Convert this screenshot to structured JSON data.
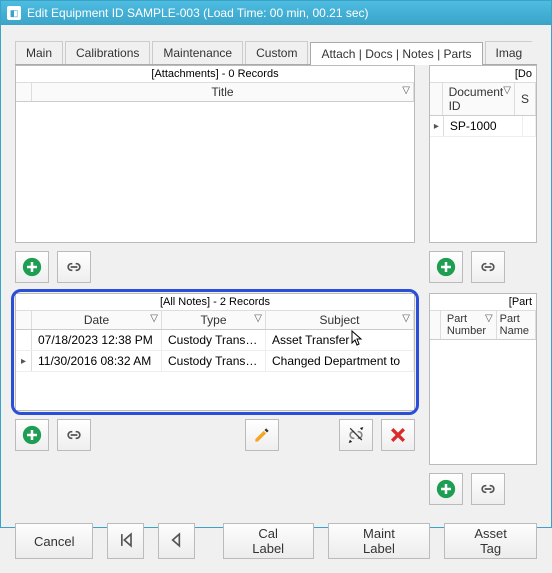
{
  "window": {
    "title": "Edit Equipment ID SAMPLE-003 (Load Time: 00 min, 00.21 sec)"
  },
  "tabs": {
    "main": "Main",
    "cal": "Calibrations",
    "maint": "Maintenance",
    "custom": "Custom",
    "attach": "Attach | Docs | Notes | Parts",
    "imag": "Imag"
  },
  "attach": {
    "caption": "[Attachments] - 0 Records",
    "col_title": "Title"
  },
  "docs": {
    "caption": "[Do",
    "col_id": "Document ID",
    "col_s": "S",
    "rows": [
      {
        "id": "SP-1000"
      }
    ]
  },
  "notes": {
    "caption": "[All Notes] - 2 Records",
    "col_date": "Date",
    "col_type": "Type",
    "col_subject": "Subject",
    "rows": [
      {
        "date": "07/18/2023 12:38 PM",
        "type": "Custody Transfer",
        "subject": "Asset Transfer"
      },
      {
        "date": "11/30/2016 08:32 AM",
        "type": "Custody Transfer",
        "subject": "Changed Department to"
      }
    ]
  },
  "parts": {
    "caption": "[Part",
    "col_num": "Part Number",
    "col_name": "Part Name"
  },
  "footer": {
    "cancel": "Cancel",
    "cal_label": "Cal Label",
    "maint_label": "Maint Label",
    "asset_tag": "Asset Tag"
  }
}
